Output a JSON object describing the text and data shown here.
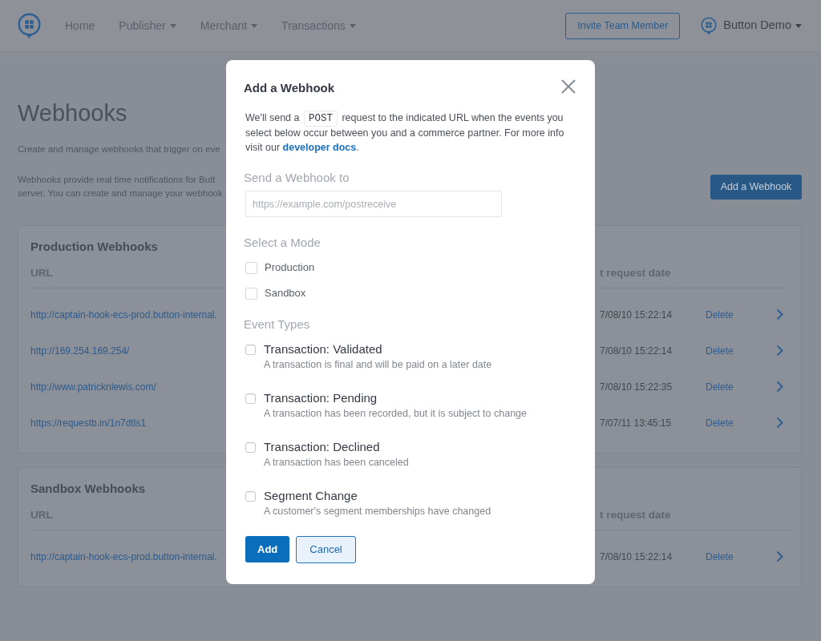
{
  "nav": {
    "items": [
      {
        "label": "Home",
        "dropdown": false
      },
      {
        "label": "Publisher",
        "dropdown": true
      },
      {
        "label": "Merchant",
        "dropdown": true
      },
      {
        "label": "Transactions",
        "dropdown": true
      }
    ],
    "invite_button": "Invite Team Member",
    "account": {
      "label": "Button Demo",
      "dropdown": true
    }
  },
  "page": {
    "title": "Webhooks",
    "intro": "Create and manage webhooks that trigger on eve",
    "description_lines": [
      "Webhooks provide real time notifications for Butt",
      "server. You can create and manage your webhook"
    ],
    "add_button": "Add a Webhook"
  },
  "sections": [
    {
      "title": "Production Webhooks",
      "columns": [
        "URL",
        "t request date"
      ],
      "rows": [
        {
          "url": "http://captain-hook-ecs-prod.button-internal.",
          "date": "7/08/10 15:22:14",
          "action": "Delete"
        },
        {
          "url": "http://169.254.169.254/",
          "date": "7/08/10 15:22:14",
          "action": "Delete"
        },
        {
          "url": "http://www.patricknlewis.com/",
          "date": "7/08/10 15:22:35",
          "action": "Delete"
        },
        {
          "url": "https://requestb.in/1n7dtls1",
          "date": "7/07/11 13:45:15",
          "action": "Delete"
        }
      ]
    },
    {
      "title": "Sandbox Webhooks",
      "columns": [
        "URL",
        "t request date"
      ],
      "rows": [
        {
          "url": "http://captain-hook-ecs-prod.button-internal.",
          "date": "7/08/10 15:22:14",
          "action": "Delete"
        }
      ]
    }
  ],
  "modal": {
    "title": "Add a Webhook",
    "intro": {
      "text_before": "We'll send a",
      "code": "POST",
      "text_after": "request to the indicated URL when the events you select below occur between you and a commerce partner. For more info visit our",
      "link": "developer docs",
      "text_end": "."
    },
    "url_field": {
      "label": "Send a Webhook to",
      "placeholder": "https://example.com/postreceive"
    },
    "mode": {
      "label": "Select a Mode",
      "options": [
        {
          "label": "Production",
          "checked": false
        },
        {
          "label": "Sandbox",
          "checked": false
        }
      ]
    },
    "events": {
      "label": "Event Types",
      "options": [
        {
          "title": "Transaction: Validated",
          "description": "A transaction is final and will be paid on a later date",
          "checked": false
        },
        {
          "title": "Transaction: Pending",
          "description": "A transaction has been recorded, but it is subject to change",
          "checked": false
        },
        {
          "title": "Transaction: Declined",
          "description": "A transaction has been canceled",
          "checked": false
        },
        {
          "title": "Segment Change",
          "description": "A customer's segment memberships have changed",
          "checked": false
        }
      ]
    },
    "buttons": [
      {
        "label": "Add",
        "kind": "primary"
      },
      {
        "label": "Cancel",
        "kind": "secondary"
      }
    ]
  }
}
